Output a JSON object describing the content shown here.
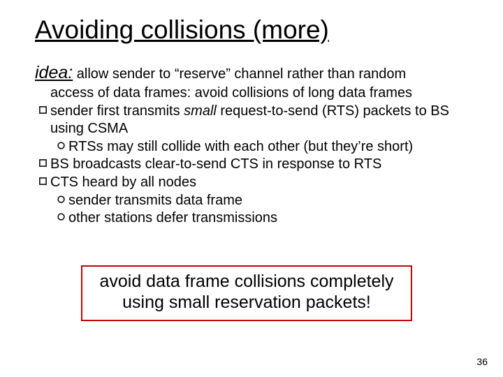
{
  "title": "Avoiding collisions (more)",
  "idea": {
    "label": "idea:",
    "text_line1": " allow sender to “reserve” channel rather than random",
    "text_line2": "access of data frames: avoid  collisions of long  data frames"
  },
  "bullets": [
    {
      "level": 0,
      "icon": "square",
      "text_pre": "sender first transmits ",
      "text_em": "small",
      "text_post": " request-to-send (RTS) packets to BS using CSMA"
    },
    {
      "level": 1,
      "icon": "circle",
      "text": "RTSs may still collide with each other (but they’re short)"
    },
    {
      "level": 0,
      "icon": "square",
      "text": "BS broadcasts clear-to-send CTS in response to RTS"
    },
    {
      "level": 0,
      "icon": "square",
      "text": "CTS heard by all nodes"
    },
    {
      "level": 1,
      "icon": "circle",
      "text": "sender transmits data frame"
    },
    {
      "level": 1,
      "icon": "circle",
      "text": "other stations defer transmissions"
    }
  ],
  "boxed_line1": "avoid data frame collisions completely",
  "boxed_line2": "using small reservation packets!",
  "page_number": "36"
}
